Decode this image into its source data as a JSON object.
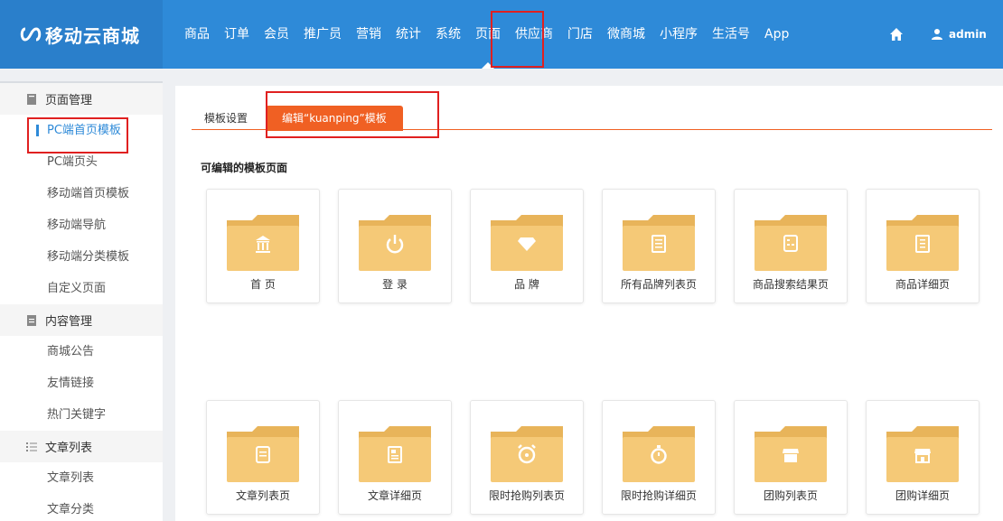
{
  "app": {
    "logo_text": "移动云商城"
  },
  "nav": {
    "items": [
      "商品",
      "订单",
      "会员",
      "推广员",
      "营销",
      "统计",
      "系统",
      "页面",
      "供应商",
      "门店",
      "微商城",
      "小程序",
      "生活号",
      "App"
    ],
    "active": "页面"
  },
  "user": {
    "name": "admin"
  },
  "sidebar": {
    "groups": [
      {
        "title": "页面管理",
        "items": [
          "PC端首页模板",
          "PC端页头",
          "移动端首页模板",
          "移动端导航",
          "移动端分类模板",
          "自定义页面"
        ]
      },
      {
        "title": "内容管理",
        "items": [
          "商城公告",
          "友情链接",
          "热门关键字"
        ]
      },
      {
        "title": "文章列表",
        "items": [
          "文章列表",
          "文章分类"
        ]
      }
    ],
    "active_item": "PC端首页模板"
  },
  "tabs": {
    "settings": "模板设置",
    "edit": "编辑“kuanping”模板"
  },
  "section": {
    "title": "可编辑的模板页面"
  },
  "cards": {
    "row1": [
      "首 页",
      "登 录",
      "品 牌",
      "所有品牌列表页",
      "商品搜索结果页",
      "商品详细页"
    ],
    "row2": [
      "文章列表页",
      "文章详细页",
      "限时抢购列表页",
      "限时抢购详细页",
      "团购列表页",
      "团购详细页"
    ]
  },
  "colors": {
    "primary": "#2e8ad8",
    "accent": "#f06023",
    "highlight": "#e02020",
    "folder": "#f5c977"
  }
}
